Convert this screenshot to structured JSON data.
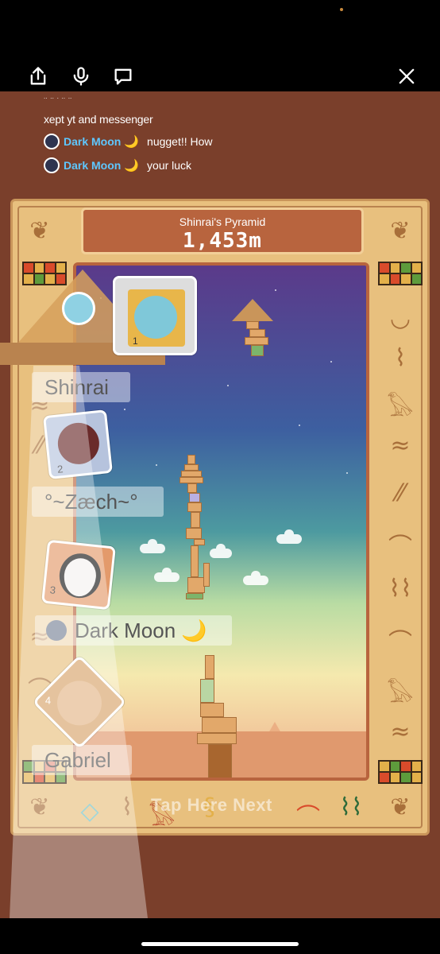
{
  "app": {
    "toolbar": {
      "icons": [
        "share-icon",
        "microphone-icon",
        "comment-icon",
        "close-icon"
      ]
    }
  },
  "chat": {
    "partial_line": "\" \" ' \" \"",
    "line1": "xept yt and messenger",
    "messages": [
      {
        "user": "Dark Moon",
        "emoji": "🌙",
        "text": "nugget!! How"
      },
      {
        "user": "Dark Moon",
        "emoji": "🌙",
        "text": "your luck"
      }
    ]
  },
  "game": {
    "title": "Shinrai's Pyramid",
    "height_value": "1,453m",
    "tap_hint": "Tap Here Next",
    "current_card_rank": "1",
    "leaderboard": [
      {
        "rank": "1",
        "name": "Shinrai"
      },
      {
        "rank": "2",
        "name": "°~Zæch~°"
      },
      {
        "rank": "3",
        "name": "Dark Moon 🌙"
      },
      {
        "rank": "4",
        "name": "Gabriel"
      }
    ]
  },
  "colors": {
    "background": "#7a3f2b",
    "board": "#e8c07e",
    "score_box": "#b8643e",
    "chat_name": "#5ec7ff"
  }
}
